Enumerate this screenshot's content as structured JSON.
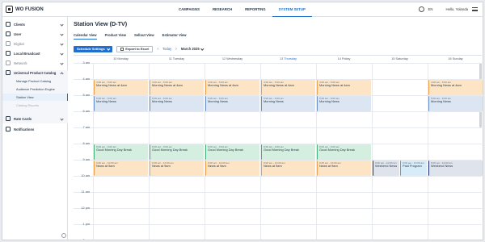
{
  "app": {
    "logo": "WO FUSION"
  },
  "topnav": {
    "items": [
      "CAMPAIGNS",
      "RESEARCH",
      "REPORTING",
      "SYSTEM SETUP"
    ],
    "active_index": 3
  },
  "user": {
    "language": "EN",
    "greeting": "Hello, Yolanda"
  },
  "sidebar": {
    "items": [
      {
        "label": "Clients",
        "icon": "building-icon",
        "muted": false
      },
      {
        "label": "User",
        "icon": "user-icon",
        "muted": false
      },
      {
        "label": "Digital",
        "icon": "digital-icon",
        "muted": true
      },
      {
        "label": "Local Broadcast",
        "icon": "broadcast-icon",
        "muted": false
      },
      {
        "label": "Network",
        "icon": "network-icon",
        "muted": true
      },
      {
        "label": "Universal Product Catalog",
        "icon": "catalog-icon",
        "muted": false
      },
      {
        "label": "Rate Cards",
        "icon": "rate-card-icon",
        "muted": false
      },
      {
        "label": "Notifications",
        "icon": "bell-icon",
        "muted": false
      }
    ],
    "subitems": [
      "Manage Product Catalog",
      "Audience Prediction Engine",
      "Station View",
      "Catalog Reports"
    ],
    "active_sub": "Station View"
  },
  "page": {
    "title": "Station View (D-TV)",
    "tabs": [
      "Calendar View",
      "Product View",
      "Sellout View",
      "Estimator View"
    ],
    "active_tab": 0
  },
  "toolbar": {
    "schedule_label": "Schedule Settings",
    "export_label": "Export to Excel",
    "today_label": "Today",
    "month_label": "March 2025"
  },
  "calendar": {
    "days": [
      "10 Monday",
      "11 Tuesday",
      "12 Wednesday",
      "13 Thursday",
      "14 Friday",
      "15 Saturday",
      "16 Sunday"
    ],
    "today_index": 3,
    "hours": [
      "3 am",
      "4 am",
      "5 am",
      "6 am",
      "7 am",
      "8 am",
      "9 am",
      "10 am",
      "11 am",
      "12 pm",
      "1 pm",
      "2 pm"
    ],
    "events": [
      {
        "days": [
          0,
          1,
          2,
          3,
          4,
          6
        ],
        "time": "4:00 am - 5:00 am",
        "name": "Morning News at 4am",
        "color": "orange",
        "start": 1,
        "dur": 1
      },
      {
        "days": [
          0,
          1,
          2,
          3,
          4,
          6
        ],
        "time": "5:00 am - 6:00 am",
        "name": "Morning News",
        "color": "blue",
        "start": 2,
        "dur": 1
      },
      {
        "days": [
          0,
          1,
          2,
          3,
          4
        ],
        "time": "8:00 am - 9:00 am",
        "name": "Good Morning Day Break",
        "color": "green",
        "start": 5,
        "dur": 1
      },
      {
        "days": [
          0,
          1,
          2,
          3,
          4
        ],
        "time": "9:00 am - 10:00 am",
        "name": "News at 9am",
        "color": "orange",
        "start": 6,
        "dur": 1
      },
      {
        "days": [
          5
        ],
        "time": "9:00 am - 10:00 am",
        "name": "Weekend News",
        "color": "wknd",
        "start": 6,
        "dur": 1,
        "sub": 0
      },
      {
        "days": [
          5
        ],
        "time": "9:00 am - 10:00 am",
        "name": "Paid Program",
        "color": "paid",
        "start": 6,
        "dur": 1,
        "sub": 1
      },
      {
        "days": [
          6
        ],
        "time": "9:00 am - 10:00 am",
        "name": "Weekend News",
        "color": "wknd",
        "start": 6,
        "dur": 1
      }
    ]
  }
}
